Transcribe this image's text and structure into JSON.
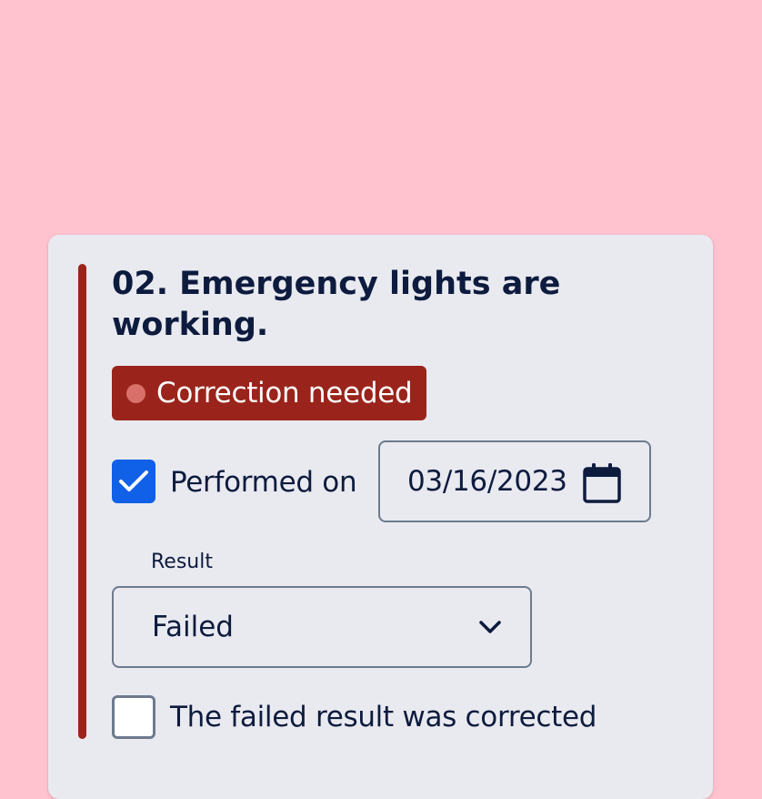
{
  "colors": {
    "page_background": "#ffc2cf",
    "card_background": "#e9eaf0",
    "status_failed": "#9a241b",
    "status_dot": "#d9706a",
    "checkbox_checked": "#1160e8",
    "text_primary": "#0d1b3e",
    "field_border": "#6e7a8e"
  },
  "item": {
    "title": "02. Emergency lights are working.",
    "status_badge": {
      "label": "Correction needed",
      "icon": "status-dot-icon"
    },
    "performed": {
      "checked": true,
      "label": "Performed on",
      "date_value": "03/16/2023",
      "date_icon": "calendar-icon"
    },
    "result": {
      "label": "Result",
      "selected_value": "Failed",
      "dropdown_icon": "chevron-down-icon"
    },
    "corrected": {
      "checked": false,
      "label": "The failed result was corrected"
    }
  }
}
